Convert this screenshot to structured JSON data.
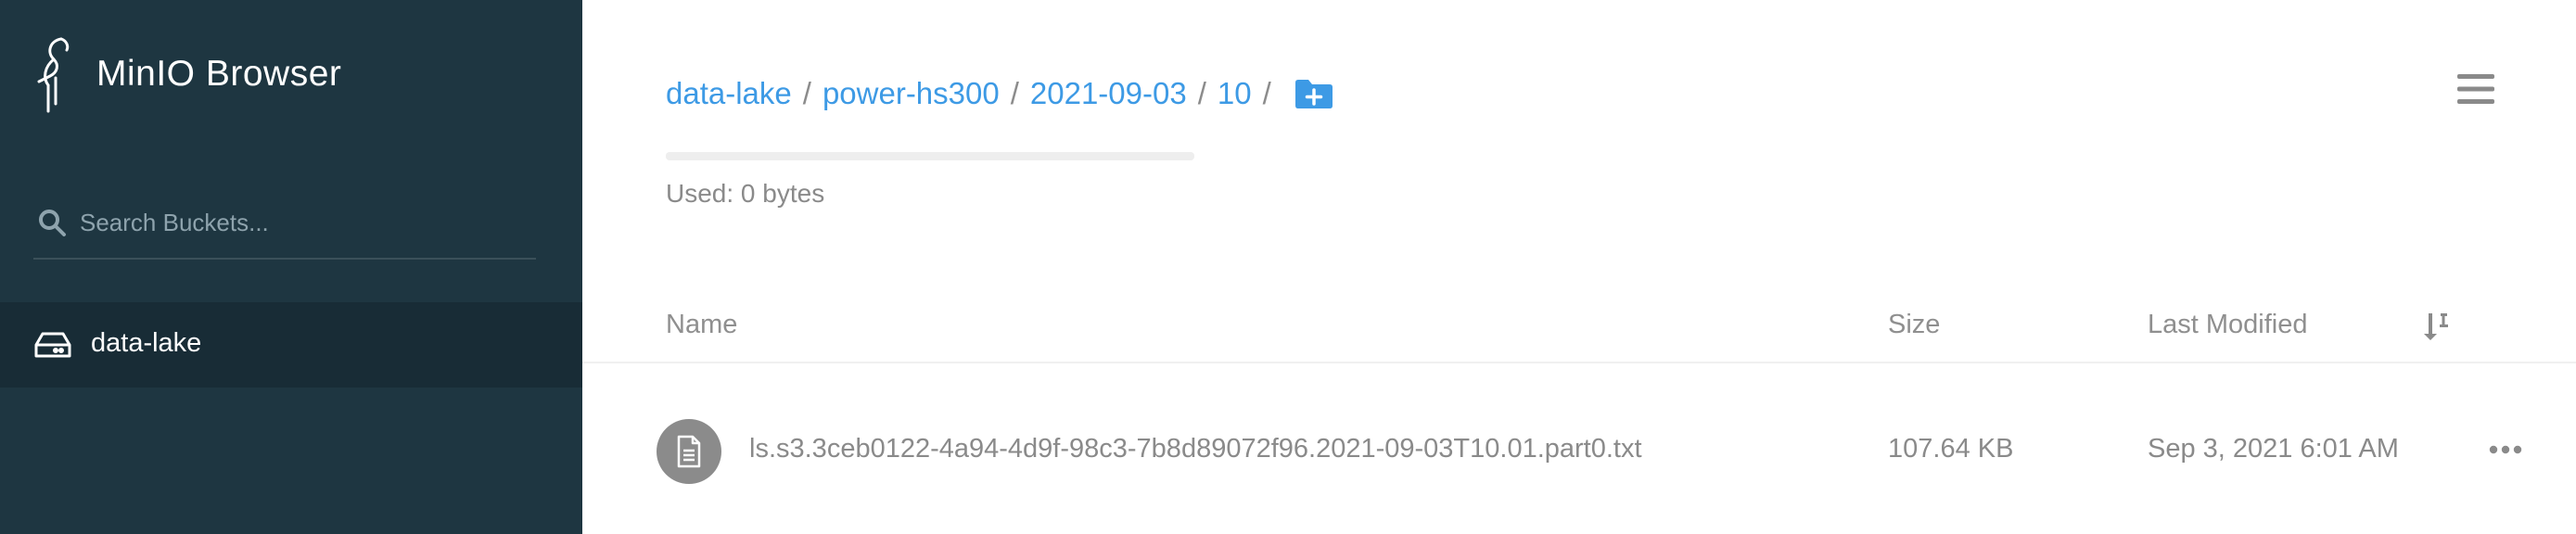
{
  "app": {
    "title": "MinIO Browser",
    "logo_icon": "minio-bird-logo"
  },
  "sidebar": {
    "search": {
      "placeholder": "Search Buckets...",
      "value": "",
      "icon": "search-icon"
    },
    "buckets": [
      {
        "label": "data-lake",
        "icon": "hard-drive-icon",
        "selected": true
      }
    ]
  },
  "breadcrumb": {
    "items": [
      "data-lake",
      "power-hs300",
      "2021-09-03",
      "10"
    ],
    "separator": "/",
    "add_folder_icon": "folder-plus-icon"
  },
  "storage": {
    "used_label": "Used: 0 bytes",
    "used_fraction": 0
  },
  "table": {
    "headers": {
      "name": "Name",
      "size": "Size",
      "last_modified": "Last Modified"
    },
    "sort_icon": "sort-icon",
    "rows": [
      {
        "icon": "file-text-icon",
        "name": "ls.s3.3ceb0122-4a94-4d9f-98c3-7b8d89072f96.2021-09-03T10.01.part0.txt",
        "size": "107.64 KB",
        "last_modified": "Sep 3, 2021 6:01 AM",
        "actions_icon": "more-horizontal-icon"
      }
    ]
  },
  "colors": {
    "sidebar_bg": "#1e3641",
    "sidebar_selected_bg": "#182c36",
    "accent": "#3d9ae5",
    "muted_text": "#8a8a8a"
  }
}
